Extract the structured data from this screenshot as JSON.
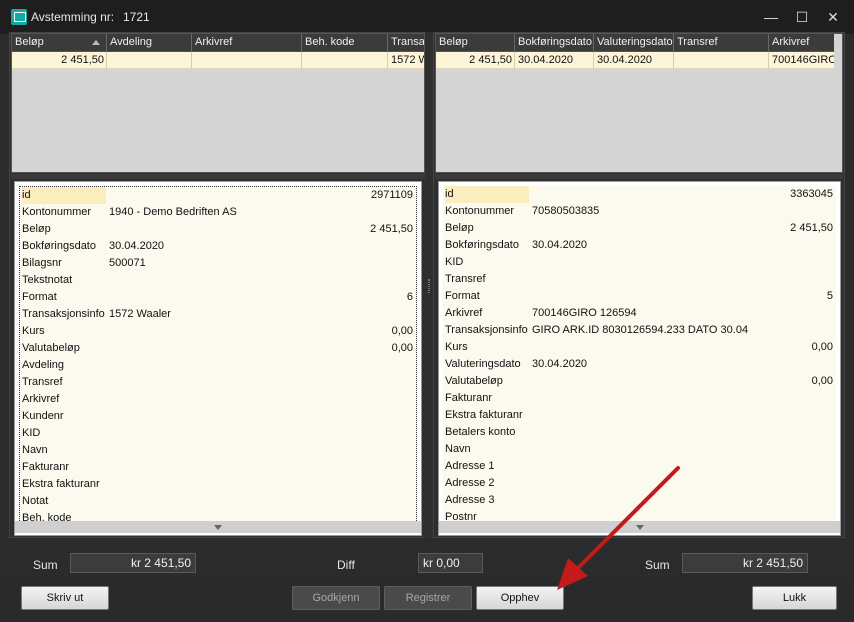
{
  "window": {
    "title_label": "Avstemming nr:",
    "title_value": "1721",
    "minimize_glyph": "—",
    "maximize_glyph": "☐",
    "close_glyph": "✕"
  },
  "left_grid": {
    "columns": [
      "Beløp",
      "Avdeling",
      "Arkivref",
      "Beh. kode",
      "Transak"
    ],
    "row": [
      "2 451,50",
      "",
      "",
      "",
      "1572 W"
    ]
  },
  "right_grid": {
    "columns": [
      "Beløp",
      "Bokføringsdato",
      "Valuteringsdato",
      "Transref",
      "Arkivref"
    ],
    "row": [
      "2 451,50",
      "30.04.2020",
      "30.04.2020",
      "",
      "700146GIRO"
    ]
  },
  "left_details": [
    {
      "label": "id",
      "value": "2971109",
      "num": true
    },
    {
      "label": "Kontonummer",
      "value": "1940 - Demo Bedriften AS",
      "num": false
    },
    {
      "label": "Beløp",
      "value": "2 451,50",
      "num": true
    },
    {
      "label": "Bokføringsdato",
      "value": "30.04.2020",
      "num": false
    },
    {
      "label": "Bilagsnr",
      "value": "500071",
      "num": false
    },
    {
      "label": "Tekstnotat",
      "value": "",
      "num": false
    },
    {
      "label": "Format",
      "value": "6",
      "num": true
    },
    {
      "label": "Transaksjonsinfo",
      "value": "1572 Waaler",
      "num": false
    },
    {
      "label": "Kurs",
      "value": "0,00",
      "num": true
    },
    {
      "label": "Valutabeløp",
      "value": "0,00",
      "num": true
    },
    {
      "label": "Avdeling",
      "value": "",
      "num": false
    },
    {
      "label": "Transref",
      "value": "",
      "num": false
    },
    {
      "label": "Arkivref",
      "value": "",
      "num": false
    },
    {
      "label": "Kundenr",
      "value": "",
      "num": false
    },
    {
      "label": "KID",
      "value": "",
      "num": false
    },
    {
      "label": "Navn",
      "value": "",
      "num": false
    },
    {
      "label": "Fakturanr",
      "value": "",
      "num": false
    },
    {
      "label": "Ekstra fakturanr",
      "value": "",
      "num": false
    },
    {
      "label": "Notat",
      "value": "",
      "num": false
    },
    {
      "label": "Beh. kode",
      "value": "",
      "num": false
    }
  ],
  "right_details": [
    {
      "label": "id",
      "value": "3363045",
      "num": true
    },
    {
      "label": "Kontonummer",
      "value": "70580503835",
      "num": false
    },
    {
      "label": "Beløp",
      "value": "2 451,50",
      "num": true
    },
    {
      "label": "Bokføringsdato",
      "value": "30.04.2020",
      "num": false
    },
    {
      "label": "KID",
      "value": "",
      "num": false
    },
    {
      "label": "Transref",
      "value": "",
      "num": false
    },
    {
      "label": "Format",
      "value": "5",
      "num": true
    },
    {
      "label": "Arkivref",
      "value": "700146GIRO   126594",
      "num": false
    },
    {
      "label": "Transaksjonsinfo",
      "value": "GIRO ARK.ID  8030126594.233 DATO 30.04",
      "num": false
    },
    {
      "label": "Kurs",
      "value": "0,00",
      "num": true
    },
    {
      "label": "Valuteringsdato",
      "value": "30.04.2020",
      "num": false
    },
    {
      "label": "Valutabeløp",
      "value": "0,00",
      "num": true
    },
    {
      "label": "Fakturanr",
      "value": "",
      "num": false
    },
    {
      "label": "Ekstra fakturanr",
      "value": "",
      "num": false
    },
    {
      "label": "Betalers konto",
      "value": "",
      "num": false
    },
    {
      "label": "Navn",
      "value": "",
      "num": false
    },
    {
      "label": "Adresse 1",
      "value": "",
      "num": false
    },
    {
      "label": "Adresse 2",
      "value": "",
      "num": false
    },
    {
      "label": "Adresse 3",
      "value": "",
      "num": false
    },
    {
      "label": "Postnr",
      "value": "",
      "num": false
    }
  ],
  "summary": {
    "sum_label_left": "Sum",
    "sum_value_left": "kr 2 451,50",
    "diff_label": "Diff",
    "diff_value": "kr 0,00",
    "sum_label_right": "Sum",
    "sum_value_right": "kr 2 451,50"
  },
  "buttons": {
    "print": "Skriv ut",
    "approve": "Godkjenn",
    "register": "Registrer",
    "cancel": "Opphev",
    "close": "Lukk"
  },
  "colors": {
    "window_bg": "#2b2b2b",
    "row_highlight": "#fcf5d8",
    "annotation_arrow": "#c41a1a"
  }
}
